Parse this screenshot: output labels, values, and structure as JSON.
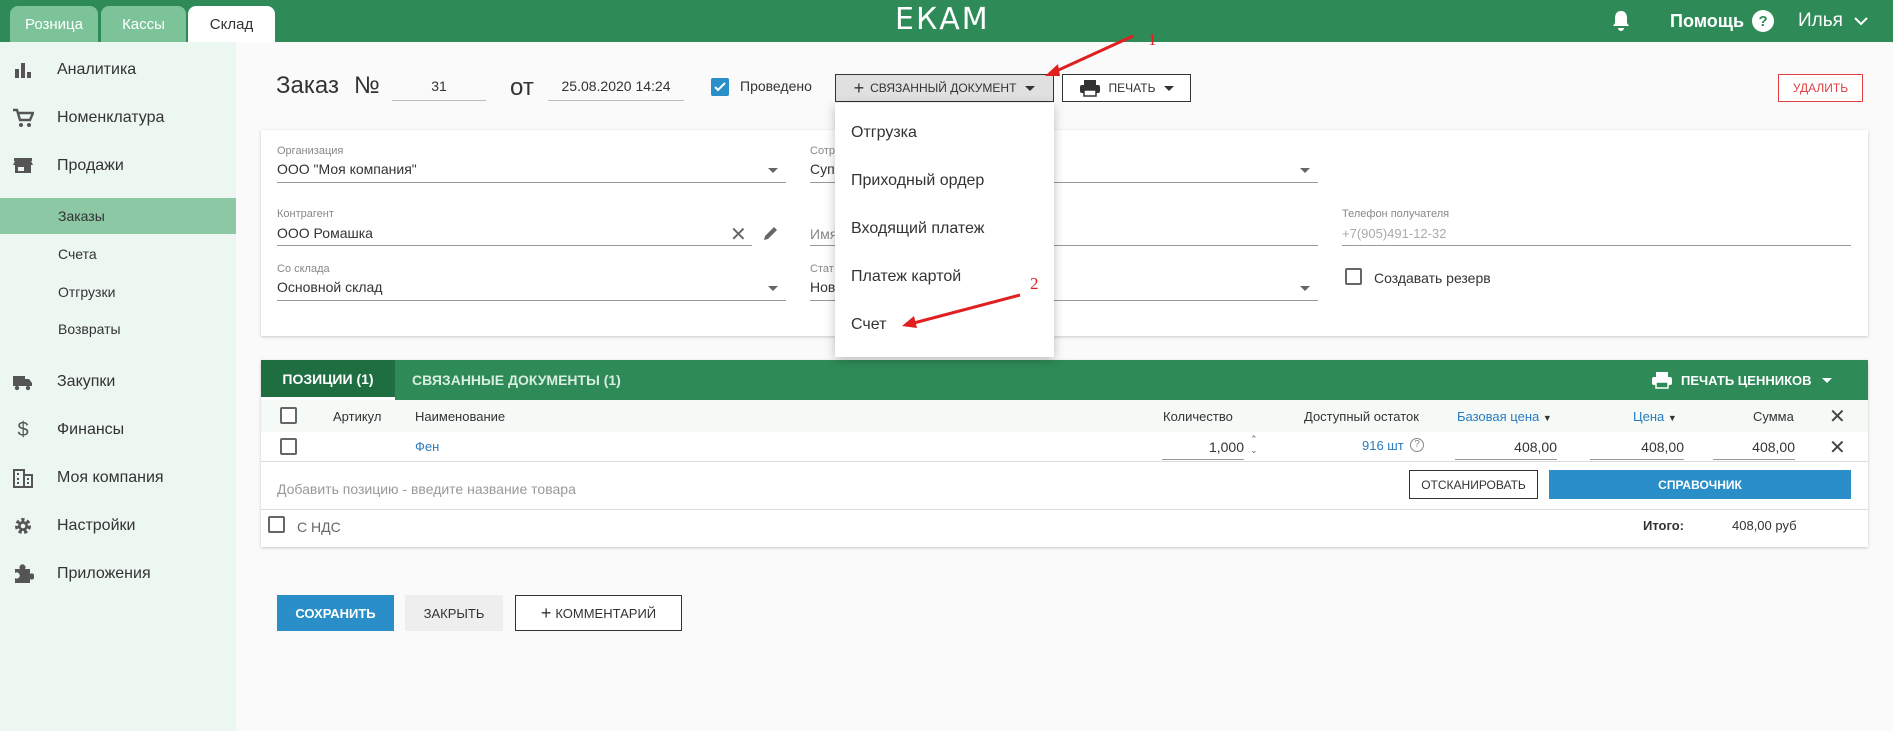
{
  "tabs": [
    "Розница",
    "Кассы",
    "Склад"
  ],
  "logo": "ЕКАМ",
  "header": {
    "help": "Помощь",
    "user": "Илья"
  },
  "sidebar": {
    "items": [
      "Аналитика",
      "Номенклатура",
      "Продажи",
      "Закупки",
      "Финансы",
      "Моя компания",
      "Настройки",
      "Приложения"
    ],
    "subitems": [
      "Заказы",
      "Счета",
      "Отгрузки",
      "Возвраты"
    ]
  },
  "order": {
    "title": "Заказ",
    "number_sign": "№",
    "number": "31",
    "from": "от",
    "date": "25.08.2020 14:24",
    "posted_label": "Проведено",
    "related_doc_btn": "Связанный документ",
    "print_btn": "Печать",
    "delete_btn": "Удалить"
  },
  "dropdown": [
    "Отгрузка",
    "Приходный ордер",
    "Входящий платеж",
    "Платеж картой",
    "Счет"
  ],
  "form": {
    "org_label": "Организация",
    "org_value": "ООО \"Моя компания\"",
    "resp_label": "Сотр",
    "resp_value": "Супе",
    "contractor_label": "Контрагент",
    "contractor_value": "ООО Ромашка",
    "name_label": "Имя",
    "phone_label": "Телефон получателя",
    "phone_placeholder": "+7(905)491-12-32",
    "warehouse_label": "Со склада",
    "warehouse_value": "Основной склад",
    "status_label": "Стат",
    "status_value": "Нов",
    "reserve_label": "Создавать резерв"
  },
  "positions": {
    "tab_positions": "Позиции (1)",
    "tab_related": "Связанные документы (1)",
    "print_prices": "Печать ценников",
    "headers": {
      "article": "Артикул",
      "name": "Наименование",
      "qty": "Количество",
      "stock": "Доступный остаток",
      "base_price": "Базовая цена",
      "price": "Цена",
      "sum": "Сумма"
    },
    "rows": [
      {
        "article": "",
        "name": "Фен",
        "qty": "1,000",
        "stock": "916 шт",
        "base_price": "408,00",
        "price": "408,00",
        "sum": "408,00"
      }
    ],
    "add_placeholder": "Добавить позицию - введите название товара",
    "scan_btn": "Отсканировать",
    "catalog_btn": "Справочник",
    "vat_label": "С НДС",
    "total_label": "Итого:",
    "total_value": "408,00 руб"
  },
  "footer": {
    "save": "Сохранить",
    "close": "Закрыть",
    "comment": "Комментарий"
  },
  "annotations": [
    "1",
    "2"
  ],
  "colors": {
    "brand": "#2e8b57",
    "accent_blue": "#2a8fc9",
    "active_sub": "#8cc8a4",
    "annotation": "#e02020"
  }
}
